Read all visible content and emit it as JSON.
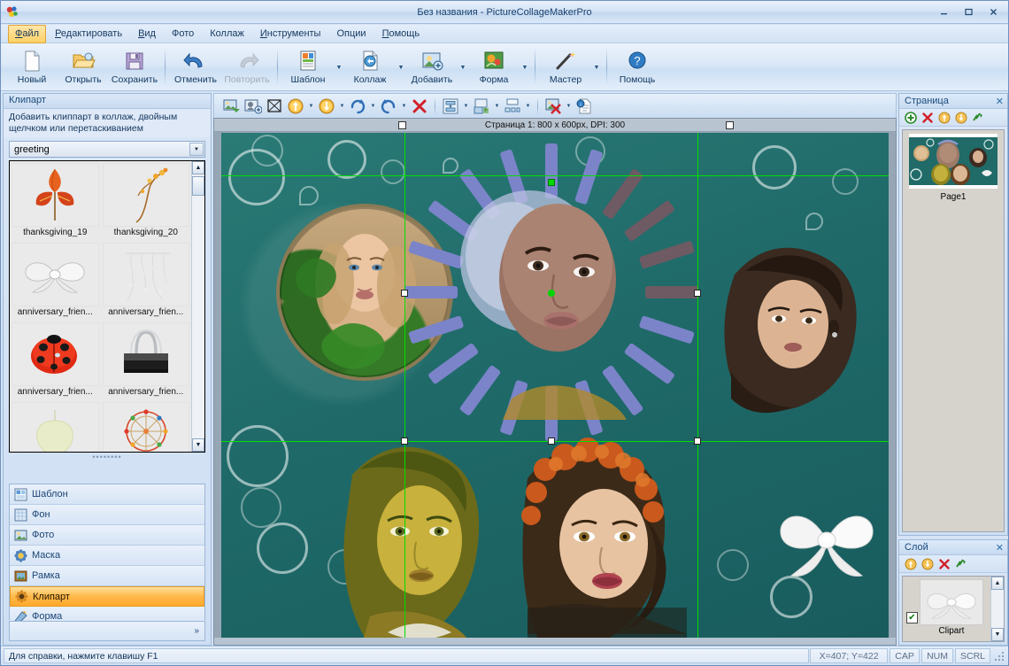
{
  "window": {
    "title": "Без названия - PictureCollageMakerPro",
    "minimize": "—",
    "maximize": "❐",
    "close": "✕"
  },
  "menu": {
    "items": [
      {
        "label": "Файл",
        "accel": "Ф",
        "active": true
      },
      {
        "label": "Редактировать",
        "accel": "Р",
        "active": false
      },
      {
        "label": "Вид",
        "accel": "В",
        "active": false
      },
      {
        "label": "Фото",
        "accel": "",
        "active": false
      },
      {
        "label": "Коллаж",
        "accel": "",
        "active": false
      },
      {
        "label": "Инструменты",
        "accel": "И",
        "active": false
      },
      {
        "label": "Опции",
        "accel": "",
        "active": false
      },
      {
        "label": "Помощь",
        "accel": "П",
        "active": false
      }
    ]
  },
  "toolbar": {
    "buttons": [
      {
        "label": "Новый",
        "icon": "new-document-icon",
        "dropdown": false,
        "disabled": false
      },
      {
        "label": "Открыть",
        "icon": "open-folder-icon",
        "dropdown": false,
        "disabled": false
      },
      {
        "label": "Сохранить",
        "icon": "save-floppy-icon",
        "dropdown": false,
        "disabled": false
      },
      {
        "label": "Отменить",
        "icon": "undo-arrow-icon",
        "dropdown": false,
        "disabled": false
      },
      {
        "label": "Повторить",
        "icon": "redo-arrow-icon",
        "dropdown": false,
        "disabled": true
      },
      {
        "label": "Шаблон",
        "icon": "template-icon",
        "dropdown": true,
        "disabled": false
      },
      {
        "label": "Коллаж",
        "icon": "collage-icon",
        "dropdown": true,
        "disabled": false
      },
      {
        "label": "Добавить",
        "icon": "add-photo-icon",
        "dropdown": true,
        "disabled": false
      },
      {
        "label": "Форма",
        "icon": "shape-icon",
        "dropdown": true,
        "disabled": false
      },
      {
        "label": "Мастер",
        "icon": "wizard-wand-icon",
        "dropdown": true,
        "disabled": false
      },
      {
        "label": "Помощь",
        "icon": "help-question-icon",
        "dropdown": false,
        "disabled": false
      }
    ]
  },
  "toolbar2": {
    "buttons": [
      {
        "name": "add-image-icon",
        "dropdown": false
      },
      {
        "name": "add-mask-icon",
        "dropdown": false
      },
      {
        "name": "crop-transform-icon",
        "dropdown": false
      },
      {
        "name": "bring-forward-icon",
        "dropdown": true
      },
      {
        "name": "send-backward-icon",
        "dropdown": true
      },
      {
        "name": "rotate-right-icon",
        "dropdown": true
      },
      {
        "name": "rotate-left-icon",
        "dropdown": true
      },
      {
        "name": "delete-red-x-icon",
        "dropdown": false
      },
      {
        "name": "align-vertical-icon",
        "dropdown": true
      },
      {
        "name": "flip-horizontal-icon",
        "dropdown": true
      },
      {
        "name": "distribute-icon",
        "dropdown": true
      },
      {
        "name": "remove-background-icon",
        "dropdown": true
      },
      {
        "name": "properties-info-icon",
        "dropdown": false
      }
    ]
  },
  "clipart": {
    "panel_title": "Клипарт",
    "hint": "Добавить клиппарт в коллаж, двойным щелчком или перетаскиванием",
    "category_value": "greeting",
    "items": [
      {
        "label": "thanksgiving_19",
        "icon": "autumn-leaf-clipart"
      },
      {
        "label": "thanksgiving_20",
        "icon": "autumn-branch-clipart"
      },
      {
        "label": "anniversary_frien...",
        "icon": "white-bow-clipart"
      },
      {
        "label": "anniversary_frien...",
        "icon": "pearl-strand-clipart"
      },
      {
        "label": "anniversary_frien...",
        "icon": "ladybug-clipart"
      },
      {
        "label": "anniversary_frien...",
        "icon": "binder-clip-clipart"
      },
      {
        "label": "",
        "icon": "pale-blob-clipart"
      },
      {
        "label": "",
        "icon": "ferris-wheel-clipart"
      }
    ]
  },
  "categories": {
    "items": [
      {
        "label": "Шаблон",
        "icon": "template-category-icon",
        "selected": false
      },
      {
        "label": "Фон",
        "icon": "background-category-icon",
        "selected": false
      },
      {
        "label": "Фото",
        "icon": "photo-category-icon",
        "selected": false
      },
      {
        "label": "Маска",
        "icon": "mask-category-icon",
        "selected": false
      },
      {
        "label": "Рамка",
        "icon": "frame-category-icon",
        "selected": false
      },
      {
        "label": "Клипарт",
        "icon": "clipart-category-icon",
        "selected": true
      },
      {
        "label": "Форма",
        "icon": "shape-category-icon",
        "selected": false
      }
    ],
    "expand_label": "»"
  },
  "canvas": {
    "page_info": "Страница 1: 800 x 600px, DPI: 300",
    "selection_color": "#00e000",
    "document_bg": "#1f6a69"
  },
  "page_panel": {
    "title": "Страница",
    "close": "✕",
    "tools": [
      {
        "name": "add-page-icon"
      },
      {
        "name": "delete-page-icon"
      },
      {
        "name": "move-page-up-icon"
      },
      {
        "name": "move-page-down-icon"
      },
      {
        "name": "refresh-pages-icon"
      }
    ],
    "pages": [
      {
        "name": "Page1"
      }
    ]
  },
  "layer_panel": {
    "title": "Слой",
    "close": "✕",
    "tools": [
      {
        "name": "layer-up-icon"
      },
      {
        "name": "layer-down-icon"
      },
      {
        "name": "delete-layer-icon"
      },
      {
        "name": "refresh-layers-icon"
      }
    ],
    "layers": [
      {
        "name": "Clipart",
        "visible": true,
        "check": "✔"
      }
    ]
  },
  "statusbar": {
    "hint": "Для справки, нажмите клавишу F1",
    "coords": "X=407; Y=422",
    "cap": "CAP",
    "num": "NUM",
    "scrl": "SCRL"
  }
}
